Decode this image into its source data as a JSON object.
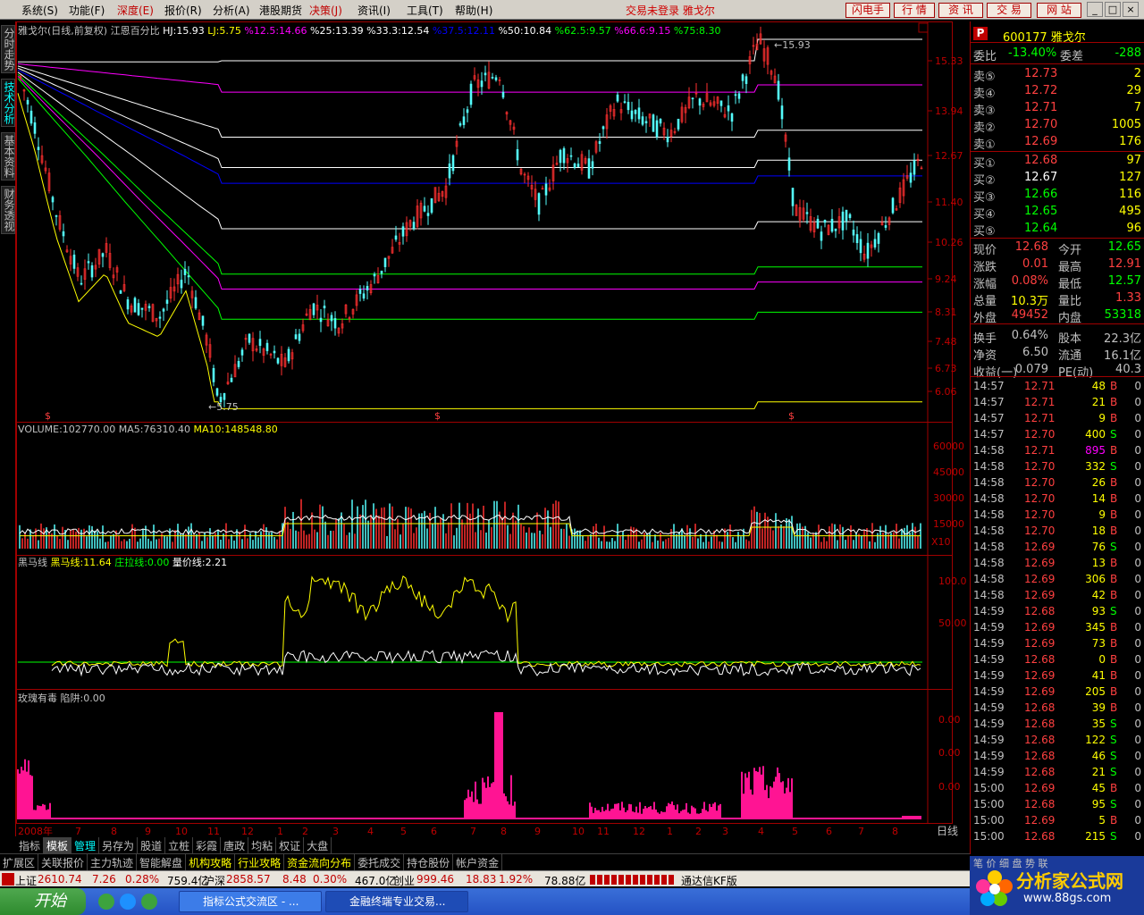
{
  "menu": {
    "items": [
      "系统(S)",
      "功能(F)",
      "深度(E)",
      "报价(R)",
      "分析(A)",
      "港股期货",
      "决策(J)",
      "资讯(I)",
      "工具(T)",
      "帮助(H)"
    ],
    "status": "交易未登录  雅戈尔",
    "right_buttons": [
      "闪电手",
      "行 情",
      "资 讯",
      "交 易",
      "网 站"
    ],
    "window_controls": [
      "_",
      "□",
      "×"
    ]
  },
  "left_tabs": [
    {
      "label": "分时走势",
      "active": false
    },
    {
      "label": "技术分析",
      "active": true
    },
    {
      "label": "基本资料",
      "active": false
    },
    {
      "label": "财务透视",
      "active": false
    }
  ],
  "main_chart": {
    "title": "雅戈尔(日线,前复权)",
    "indicator_name": "江恩百分比",
    "params": [
      {
        "text": "HJ:15.93",
        "color": "#ffffff"
      },
      {
        "text": "LJ:5.75",
        "color": "#ffff00"
      },
      {
        "text": "%12.5:14.66",
        "color": "#ff00ff"
      },
      {
        "text": "%25:13.39",
        "color": "#ffffff"
      },
      {
        "text": "%33.3:12.54",
        "color": "#ffffff"
      },
      {
        "text": "%37.5:12.11",
        "color": "#0000ff"
      },
      {
        "text": "%50:10.84",
        "color": "#ffffff"
      },
      {
        "text": "%62.5:9.57",
        "color": "#00ff00"
      },
      {
        "text": "%66.6:9.15",
        "color": "#ff00ff"
      },
      {
        "text": "%75:8.30",
        "color": "#00ff00"
      }
    ],
    "high_label": "15.93",
    "low_label": "5.75",
    "y_ticks": [
      "15.33",
      "13.94",
      "12.67",
      "11.40",
      "10.26",
      "9.24",
      "8.31",
      "7.48",
      "6.73",
      "6.06"
    ]
  },
  "volume": {
    "label": "VOLUME:102770.00",
    "ma5": "MA5:76310.40",
    "ma10": "MA10:148548.80",
    "y_ticks": [
      "60000",
      "45000",
      "30000",
      "15000"
    ],
    "unit": "X10"
  },
  "heima": {
    "label": "黑马线",
    "line1": "黑马线:11.64",
    "line2": "庄拉线:0.00",
    "line3": "量价线:2.21",
    "y_ticks": [
      "100.0",
      "50.00"
    ]
  },
  "rose": {
    "label": "玫瑰有毒",
    "trap": "陷阱:0.00",
    "y_ticks": [
      "0.00",
      "0.00",
      "0.00"
    ]
  },
  "x_axis": {
    "labels": [
      "2008年",
      "7",
      "8",
      "9",
      "10",
      "11",
      "12",
      "1",
      "2",
      "3",
      "4",
      "5",
      "6",
      "7",
      "8",
      "9",
      "10",
      "11",
      "12",
      "1",
      "2",
      "3",
      "4",
      "5",
      "6",
      "7",
      "8"
    ],
    "period": "日线"
  },
  "quote": {
    "code": "600177 雅戈尔",
    "wei_bi_label": "委比",
    "wei_bi": "-13.40%",
    "wei_cha_label": "委差",
    "wei_cha": "-288",
    "sells": [
      {
        "label": "卖⑤",
        "price": "12.73",
        "vol": "2"
      },
      {
        "label": "卖④",
        "price": "12.72",
        "vol": "29"
      },
      {
        "label": "卖③",
        "price": "12.71",
        "vol": "7"
      },
      {
        "label": "卖②",
        "price": "12.70",
        "vol": "1005"
      },
      {
        "label": "卖①",
        "price": "12.69",
        "vol": "176"
      }
    ],
    "buys": [
      {
        "label": "买①",
        "price": "12.68",
        "vol": "97"
      },
      {
        "label": "买②",
        "price": "12.67",
        "vol": "127"
      },
      {
        "label": "买③",
        "price": "12.66",
        "vol": "116"
      },
      {
        "label": "买④",
        "price": "12.65",
        "vol": "495"
      },
      {
        "label": "买⑤",
        "price": "12.64",
        "vol": "96"
      }
    ],
    "stats": [
      {
        "l1": "现价",
        "v1": "12.68",
        "c1": "#ff4040",
        "l2": "今开",
        "v2": "12.65",
        "c2": "#00ff00"
      },
      {
        "l1": "涨跌",
        "v1": "0.01",
        "c1": "#ff4040",
        "l2": "最高",
        "v2": "12.91",
        "c2": "#ff4040"
      },
      {
        "l1": "涨幅",
        "v1": "0.08%",
        "c1": "#ff4040",
        "l2": "最低",
        "v2": "12.57",
        "c2": "#00ff00"
      },
      {
        "l1": "总量",
        "v1": "10.3万",
        "c1": "#ffff00",
        "l2": "量比",
        "v2": "1.33",
        "c2": "#ff4040"
      },
      {
        "l1": "外盘",
        "v1": "49452",
        "c1": "#ff4040",
        "l2": "内盘",
        "v2": "53318",
        "c2": "#00ff00"
      },
      {
        "l1": "换手",
        "v1": "0.64%",
        "c1": "#c0c0c0",
        "l2": "股本",
        "v2": "22.3亿",
        "c2": "#c0c0c0"
      },
      {
        "l1": "净资",
        "v1": "6.50",
        "c1": "#c0c0c0",
        "l2": "流通",
        "v2": "16.1亿",
        "c2": "#c0c0c0"
      },
      {
        "l1": "收益(一)",
        "v1": "0.079",
        "c1": "#c0c0c0",
        "l2": "PE(动)",
        "v2": "40.3",
        "c2": "#c0c0c0"
      }
    ],
    "ticks": [
      {
        "t": "14:57",
        "p": "12.71",
        "v": "48",
        "s": "B",
        "n": "0"
      },
      {
        "t": "14:57",
        "p": "12.71",
        "v": "21",
        "s": "B",
        "n": "0"
      },
      {
        "t": "14:57",
        "p": "12.71",
        "v": "9",
        "s": "B",
        "n": "0"
      },
      {
        "t": "14:57",
        "p": "12.70",
        "v": "400",
        "s": "S",
        "n": "0"
      },
      {
        "t": "14:58",
        "p": "12.71",
        "v": "895",
        "s": "B",
        "n": "0",
        "big": true
      },
      {
        "t": "14:58",
        "p": "12.70",
        "v": "332",
        "s": "S",
        "n": "0"
      },
      {
        "t": "14:58",
        "p": "12.70",
        "v": "26",
        "s": "B",
        "n": "0"
      },
      {
        "t": "14:58",
        "p": "12.70",
        "v": "14",
        "s": "B",
        "n": "0"
      },
      {
        "t": "14:58",
        "p": "12.70",
        "v": "9",
        "s": "B",
        "n": "0"
      },
      {
        "t": "14:58",
        "p": "12.70",
        "v": "18",
        "s": "B",
        "n": "0"
      },
      {
        "t": "14:58",
        "p": "12.69",
        "v": "76",
        "s": "S",
        "n": "0"
      },
      {
        "t": "14:58",
        "p": "12.69",
        "v": "13",
        "s": "B",
        "n": "0"
      },
      {
        "t": "14:58",
        "p": "12.69",
        "v": "306",
        "s": "B",
        "n": "0"
      },
      {
        "t": "14:58",
        "p": "12.69",
        "v": "42",
        "s": "B",
        "n": "0"
      },
      {
        "t": "14:59",
        "p": "12.68",
        "v": "93",
        "s": "S",
        "n": "0"
      },
      {
        "t": "14:59",
        "p": "12.69",
        "v": "345",
        "s": "B",
        "n": "0"
      },
      {
        "t": "14:59",
        "p": "12.69",
        "v": "73",
        "s": "B",
        "n": "0"
      },
      {
        "t": "14:59",
        "p": "12.68",
        "v": "0",
        "s": "B",
        "n": "0"
      },
      {
        "t": "14:59",
        "p": "12.69",
        "v": "41",
        "s": "B",
        "n": "0"
      },
      {
        "t": "14:59",
        "p": "12.69",
        "v": "205",
        "s": "B",
        "n": "0"
      },
      {
        "t": "14:59",
        "p": "12.68",
        "v": "39",
        "s": "B",
        "n": "0"
      },
      {
        "t": "14:59",
        "p": "12.68",
        "v": "35",
        "s": "S",
        "n": "0"
      },
      {
        "t": "14:59",
        "p": "12.68",
        "v": "122",
        "s": "S",
        "n": "0"
      },
      {
        "t": "14:59",
        "p": "12.68",
        "v": "46",
        "s": "S",
        "n": "0"
      },
      {
        "t": "14:59",
        "p": "12.68",
        "v": "21",
        "s": "S",
        "n": "0"
      },
      {
        "t": "15:00",
        "p": "12.69",
        "v": "45",
        "s": "B",
        "n": "0"
      },
      {
        "t": "15:00",
        "p": "12.68",
        "v": "95",
        "s": "S",
        "n": "0"
      },
      {
        "t": "15:00",
        "p": "12.69",
        "v": "5",
        "s": "B",
        "n": "0"
      },
      {
        "t": "15:00",
        "p": "12.68",
        "v": "215",
        "s": "S",
        "n": "0"
      }
    ]
  },
  "bottom_tabs": [
    "指标",
    "模板",
    "管理",
    "另存为",
    "股道",
    "立桩",
    "彩霞",
    "唐政",
    "均粘",
    "权证",
    "大盘"
  ],
  "ext_tabs": [
    "扩展区",
    "关联报价",
    "主力轨迹",
    "智能解盘",
    "机构攻略",
    "行业攻略",
    "资金流向分布",
    "委托成交",
    "持仓股份",
    "帐户资金"
  ],
  "status": {
    "sh_label": "上证",
    "sh_val": "2610.74",
    "sh_chg": "7.26",
    "sh_pct": "0.28%",
    "sh_amt": "759.4亿",
    "sz_label": "沪深",
    "sz_val": "2858.57",
    "sz_chg": "8.48",
    "sz_pct": "0.30%",
    "sz_amt": "467.0亿",
    "cy_label": "创业",
    "cy_val": "999.46",
    "cy_chg": "18.83",
    "cy_pct": "1.92%",
    "cy_amt": "78.88亿",
    "server": "通达信KF版"
  },
  "taskbar": {
    "start": "开始",
    "items": [
      "指标公式交流区 - ...",
      "金融终端专业交易..."
    ]
  },
  "logo": {
    "name": "分析家公式网",
    "url": "www.88gs.com",
    "tabs": "笔  价  细  盘  势  联"
  }
}
